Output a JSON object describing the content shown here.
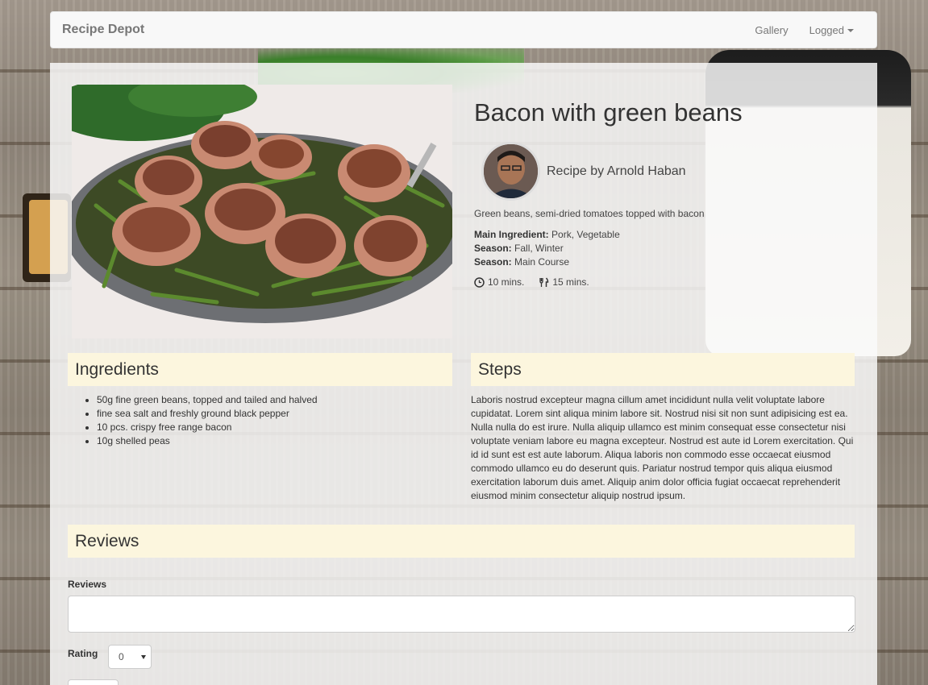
{
  "navbar": {
    "brand": "Recipe Depot",
    "gallery": "Gallery",
    "logged": "Logged"
  },
  "recipe": {
    "title": "Bacon with green beans",
    "author": "Recipe by Arnold Haban",
    "description": "Green beans, semi-dried tomatoes topped with bacon",
    "main_ingredient_label": "Main Ingredient:",
    "main_ingredient": "Pork, Vegetable",
    "season_label": "Season:",
    "season": "Fall, Winter",
    "season2_label": "Season:",
    "season2": "Main Course",
    "prep_time": "10 mins.",
    "cook_time": "15 mins."
  },
  "ingredients": {
    "heading": "Ingredients",
    "items": [
      "50g fine green beans, topped and tailed and halved",
      "fine sea salt and freshly ground black pepper",
      "10 pcs. crispy free range bacon",
      "10g shelled peas"
    ]
  },
  "steps": {
    "heading": "Steps",
    "text": "Laboris nostrud excepteur magna cillum amet incididunt nulla velit voluptate labore cupidatat. Lorem sint aliqua minim labore sit. Nostrud nisi sit non sunt adipisicing est ea. Nulla nulla do est irure. Nulla aliquip ullamco est minim consequat esse consectetur nisi voluptate veniam labore eu magna excepteur.  Nostrud est aute id Lorem exercitation. Qui id id sunt est est aute laborum. Aliqua laboris non commodo esse occaecat eiusmod commodo ullamco eu do deserunt quis.  Pariatur nostrud tempor quis aliqua eiusmod exercitation laborum duis amet. Aliquip anim dolor officia fugiat occaecat reprehenderit eiusmod minim consectetur aliquip nostrud ipsum."
  },
  "reviews": {
    "heading": "Reviews",
    "label": "Reviews",
    "value": "",
    "rating_label": "Rating",
    "rating_value": "0"
  },
  "colors": {
    "section_bg": "#fcf6de",
    "navbar_bg": "#f8f8f8"
  },
  "icons": {
    "prep": "clock-icon",
    "cook": "cutlery-icon"
  }
}
